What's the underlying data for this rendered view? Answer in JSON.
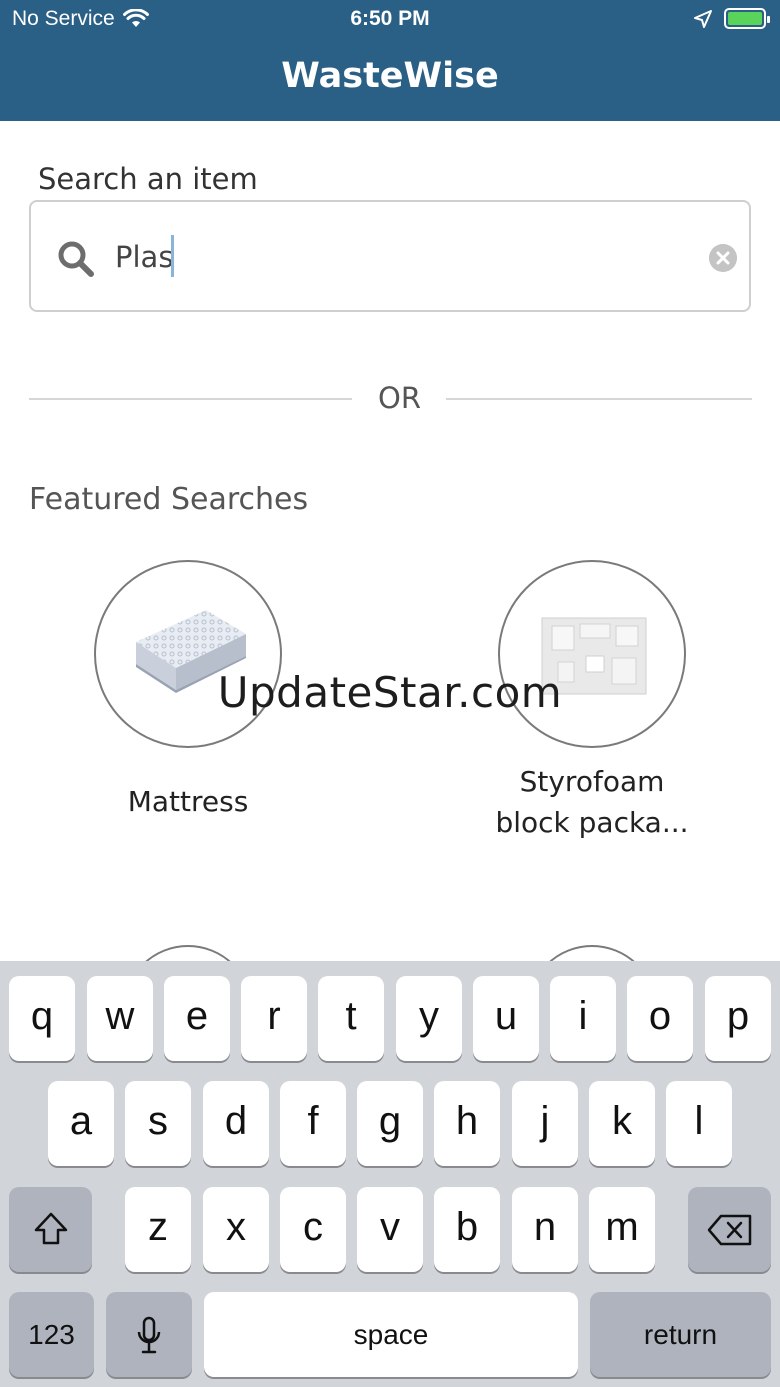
{
  "status_bar": {
    "carrier": "No Service",
    "time": "6:50 PM"
  },
  "app": {
    "title": "WasteWise",
    "header_color": "#2a5f86"
  },
  "search": {
    "label": "Search an item",
    "value": "Plas",
    "icon": "search-icon",
    "clear_icon": "clear-icon"
  },
  "divider": {
    "text": "OR"
  },
  "featured": {
    "title": "Featured Searches",
    "items": [
      {
        "label": "Mattress",
        "icon": "mattress-image"
      },
      {
        "label_line1": "Styrofoam",
        "label_line2": "block packa...",
        "icon": "styrofoam-image"
      }
    ]
  },
  "watermark": "UpdateStar.com",
  "keyboard": {
    "row1": [
      "q",
      "w",
      "e",
      "r",
      "t",
      "y",
      "u",
      "i",
      "o",
      "p"
    ],
    "row2": [
      "a",
      "s",
      "d",
      "f",
      "g",
      "h",
      "j",
      "k",
      "l"
    ],
    "row3": [
      "z",
      "x",
      "c",
      "v",
      "b",
      "n",
      "m"
    ],
    "numbers_key": "123",
    "space_key": "space",
    "return_key": "return"
  }
}
